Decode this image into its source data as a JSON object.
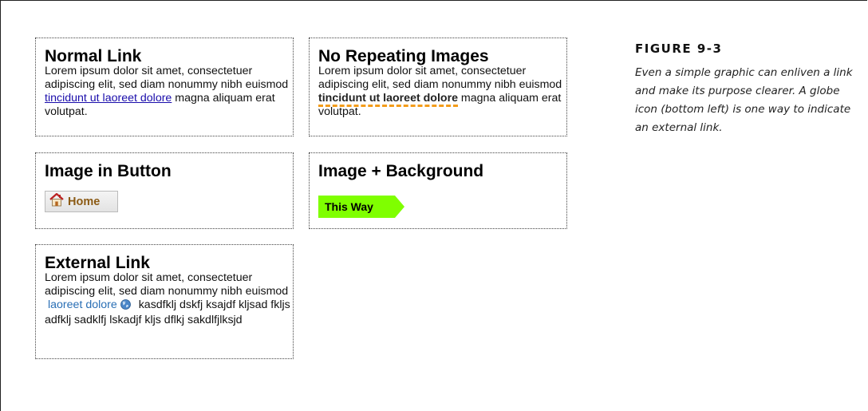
{
  "normal_link": {
    "title": "Normal Link",
    "text_before": "Lorem ipsum dolor sit amet, consectetuer adipiscing elit, sed diam nonummy nibh euismod ",
    "link": "tincidunt ut laoreet dolore",
    "text_after": " magna aliquam erat volutpat."
  },
  "no_repeat": {
    "title": "No Repeating Images",
    "text_before": "Lorem ipsum dolor sit amet, consectetuer adipiscing elit, sed diam nonummy nibh euismod ",
    "link": "tincidunt ut laoreet dolore",
    "text_after": " magna aliquam erat volutpat."
  },
  "image_button": {
    "title": "Image in Button",
    "button_label": "Home",
    "icon": "home-icon"
  },
  "image_background": {
    "title": "Image + Background",
    "button_label": "This Way",
    "button_color": "#7fff00"
  },
  "external_link": {
    "title": "External Link",
    "text_before": "Lorem ipsum dolor sit amet, consectetuer adipiscing elit, sed diam nonummy nibh euismod ",
    "link": "laoreet dolore",
    "icon": "globe-icon",
    "text_after": " kasdfklj dskfj ksajdf kljsad fkljs adfklj sadklfj lskadjf kljs dflkj sakdlfjlksjd"
  },
  "figure": {
    "label": "FIGURE 9-3",
    "caption": "Even a simple graphic can enliven a link and make its purpose clearer. A globe icon (bottom left) is one way to indicate an external link."
  }
}
